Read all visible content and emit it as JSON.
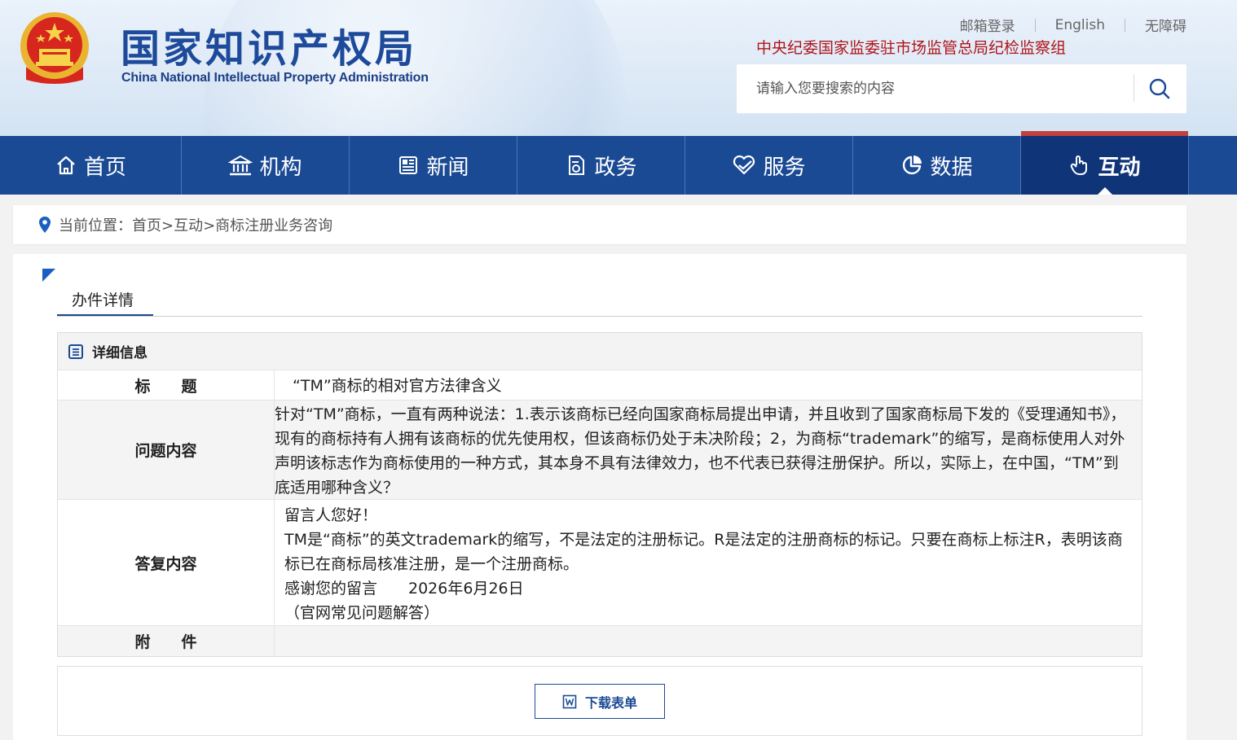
{
  "header": {
    "logo_cn": "国家知识产权局",
    "logo_en": "China National Intellectual Property Administration",
    "top_links": [
      "邮箱登录",
      "English",
      "无障碍"
    ],
    "subtitle": "中央纪委国家监委驻市场监管总局纪检监察组",
    "search_placeholder": "请输入您要搜索的内容"
  },
  "nav": {
    "items": [
      {
        "label": "首页",
        "icon": "home-icon"
      },
      {
        "label": "机构",
        "icon": "institution-icon"
      },
      {
        "label": "新闻",
        "icon": "news-icon"
      },
      {
        "label": "政务",
        "icon": "document-icon"
      },
      {
        "label": "服务",
        "icon": "heart-service-icon"
      },
      {
        "label": "数据",
        "icon": "pie-chart-icon"
      },
      {
        "label": "互动",
        "icon": "hand-pointer-icon",
        "active": true
      }
    ]
  },
  "breadcrumb": {
    "text": "当前位置：首页>互动>商标注册业务咨询"
  },
  "tab": {
    "label": "办件详情"
  },
  "detail": {
    "header": "详细信息",
    "rows": {
      "title_label": "标　　题",
      "title_value": "“TM”商标的相对官方法律含义",
      "question_label": "问题内容",
      "question_value": "  针对“TM”商标，一直有两种说法：1.表示该商标已经向国家商标局提出申请，并且收到了国家商标局下发的《受理通知书》，现有的商标持有人拥有该商标的优先使用权，但该商标仍处于未决阶段；2，为商标“trademark”的缩写，是商标使用人对外声明该标志作为商标使用的一种方式，其本身不具有法律效力，也不代表已获得注册保护。所以，实际上，在中国，“TM”到底适用哪种含义？",
      "answer_label": "答复内容",
      "answer_lines": [
        "留言人您好！",
        "TM是“商标”的英文trademark的缩写，不是法定的注册标记。R是法定的注册商标的标记。只要在商标上标注R，表明该商标已在商标局核准注册，是一个注册商标。",
        "感谢您的留言　　2026年6月26日",
        "（官网常见问题解答）"
      ],
      "attachment_label": "附　　件"
    }
  },
  "download": {
    "label": "下载表单"
  },
  "colors": {
    "nav_bg": "#1b4a94",
    "nav_active": "#0f3578",
    "accent_red": "#b0141a"
  }
}
